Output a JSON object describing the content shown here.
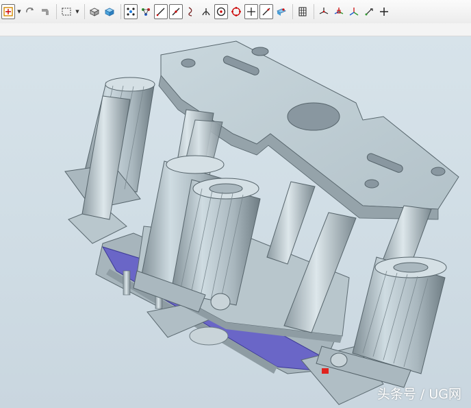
{
  "toolbar": {
    "groups": [
      [
        "snap-point-icon",
        "dropdown-arrow-icon",
        "rotate-icon",
        "pan-icon"
      ],
      [
        "select-box-icon",
        "dropdown-arrow-icon"
      ],
      [
        "shaded-box-icon",
        "solid-box-icon"
      ],
      [
        "snap-midpoint-icon",
        "snap-network-icon",
        "line-icon",
        "line-end-icon",
        "arc-tangent-icon",
        "perpendicular-icon",
        "circle-center-icon",
        "quadrant-icon",
        "intersection-icon",
        "curve-icon",
        "face-point-icon"
      ],
      [
        "grid-icon"
      ],
      [
        "wcs-icon",
        "wcs-origin-icon",
        "wcs-rotate-icon",
        "wcs-dynamic-icon",
        "cross-icon"
      ]
    ]
  },
  "model": {
    "colors": {
      "metal": "#bfcdd3",
      "metal_dark": "#8c9aa1",
      "gasket": "#6a66c7",
      "highlight": "#e0231e",
      "background": "#d2dee6"
    }
  },
  "watermark": "头条号 / UG网"
}
